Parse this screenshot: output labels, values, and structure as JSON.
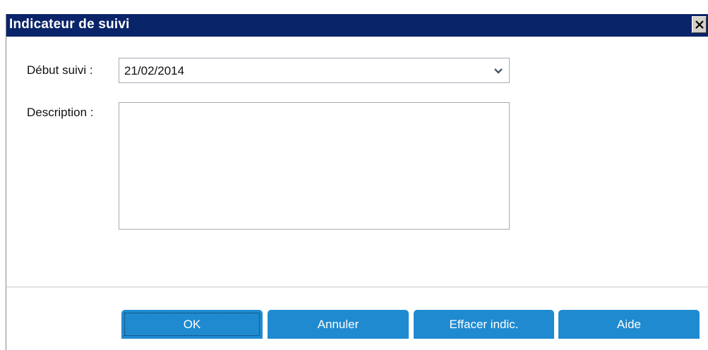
{
  "window": {
    "title": "Indicateur de suivi"
  },
  "form": {
    "start_label": "Début suivi :",
    "start_value": "21/02/2014",
    "description_label": "Description :",
    "description_value": ""
  },
  "buttons": {
    "ok": "OK",
    "cancel": "Annuler",
    "clear": "Effacer indic.",
    "help": "Aide"
  },
  "icons": {
    "close": "close-icon",
    "dropdown": "chevron-down-icon"
  },
  "colors": {
    "titlebar": "#0a246a",
    "button": "#1f8ad0"
  }
}
